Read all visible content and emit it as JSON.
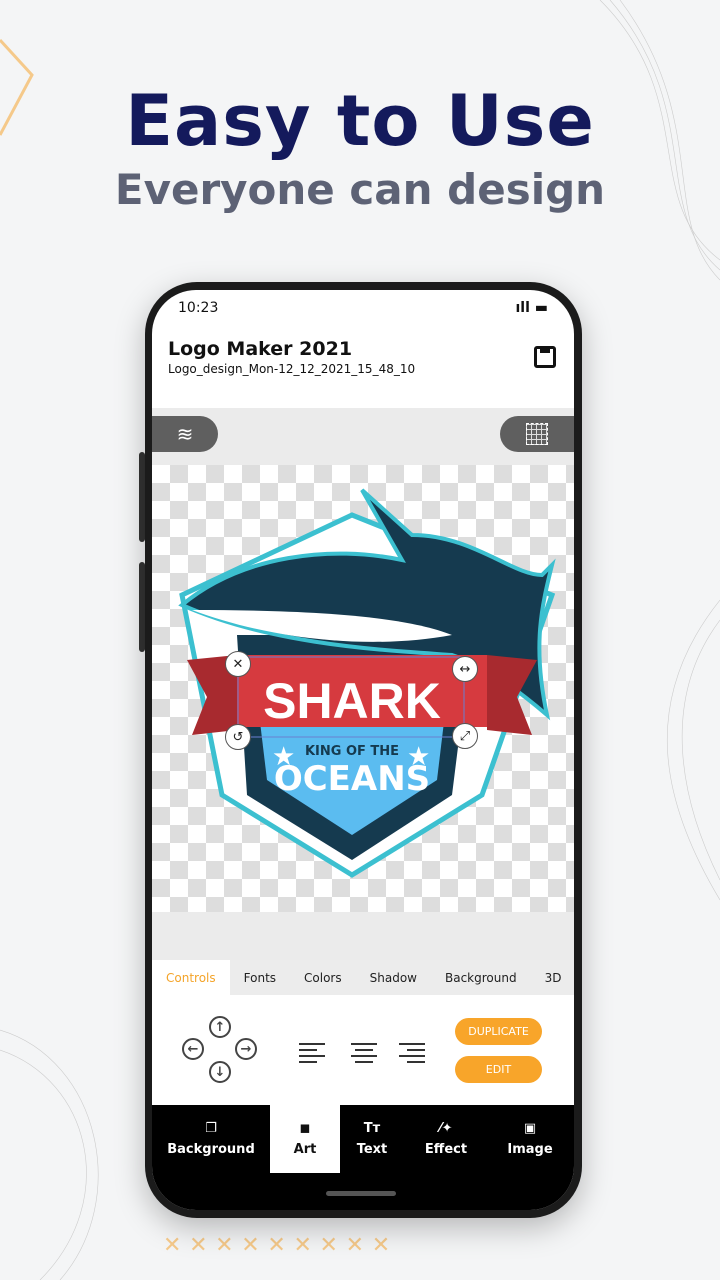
{
  "headline": "Easy to Use",
  "subheadline": "Everyone can design",
  "status": {
    "time": "10:23"
  },
  "header": {
    "title": "Logo Maker 2021",
    "filename": "Logo_design_Mon-12_12_2021_15_48_10"
  },
  "logo": {
    "title": "SHARK",
    "line1": "KING OF THE",
    "line2": "OCEANS"
  },
  "tabs": [
    {
      "label": "Controls",
      "active": true
    },
    {
      "label": "Fonts"
    },
    {
      "label": "Colors"
    },
    {
      "label": "Shadow"
    },
    {
      "label": "Background"
    },
    {
      "label": "3D"
    }
  ],
  "buttons": {
    "duplicate": "DUPLICATE",
    "edit": "EDIT"
  },
  "nav": [
    {
      "label": "Background",
      "icon": "background-icon"
    },
    {
      "label": "Art",
      "icon": "sticker-icon",
      "active": true
    },
    {
      "label": "Text",
      "icon": "text-icon"
    },
    {
      "label": "Effect",
      "icon": "magic-wand-icon"
    },
    {
      "label": "Image",
      "icon": "image-icon"
    }
  ],
  "colors": {
    "accent": "#f8a52a",
    "headline": "#141a5c",
    "banner": "#d63a3f",
    "shield": "#153a4f",
    "sky": "#5bbcf0"
  }
}
